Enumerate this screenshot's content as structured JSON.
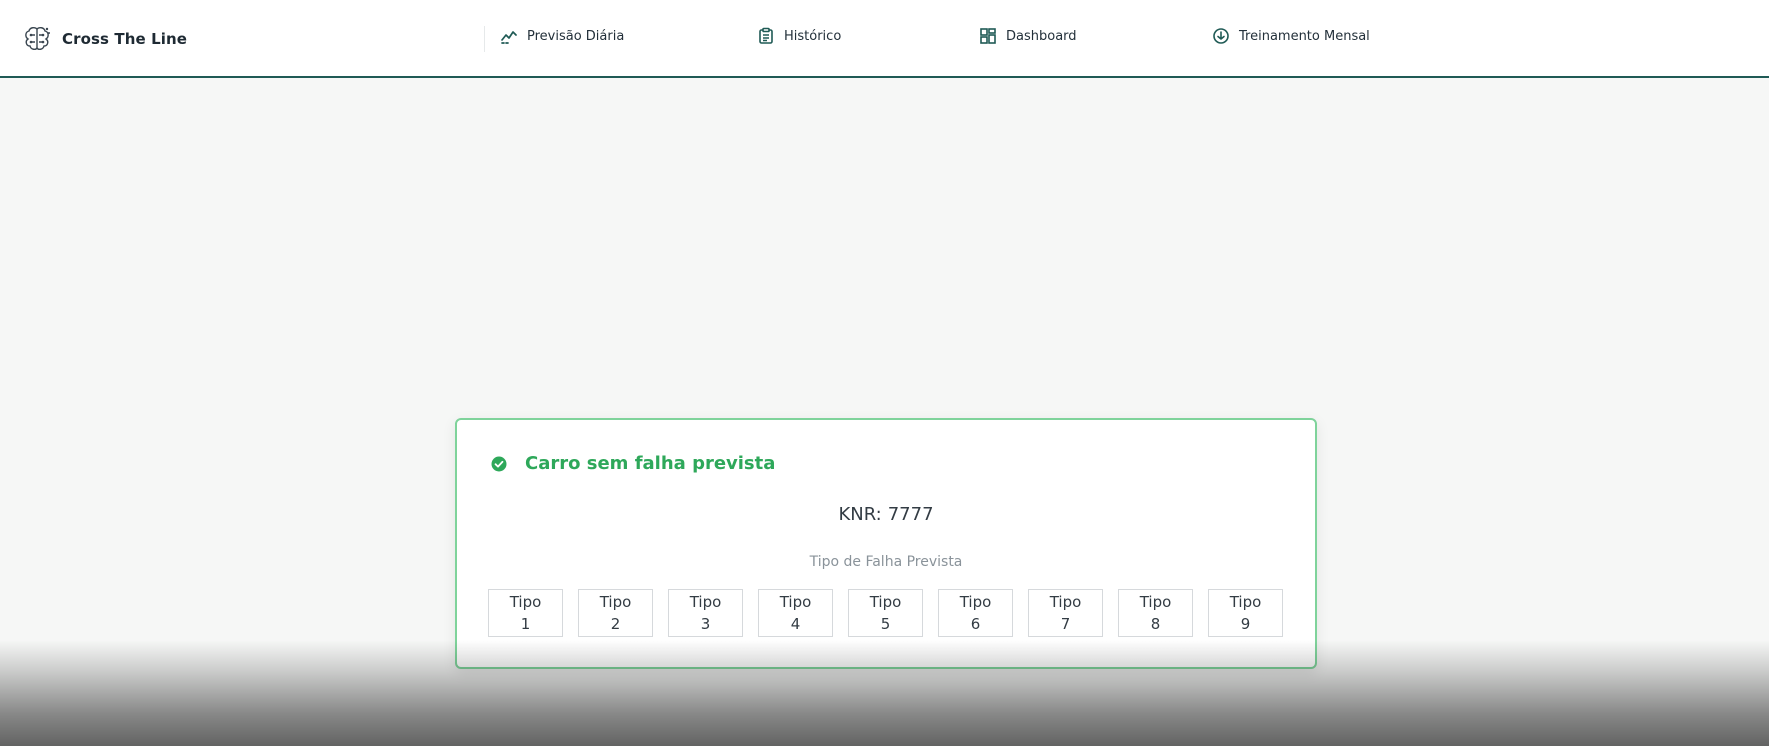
{
  "brand": {
    "name": "Cross The Line",
    "logo": "brain-circuit-icon"
  },
  "nav": [
    {
      "label": "Previsão Diária",
      "icon": "trend-chart-icon"
    },
    {
      "label": "Histórico",
      "icon": "clipboard-icon"
    },
    {
      "label": "Dashboard",
      "icon": "dashboard-grid-icon"
    },
    {
      "label": "Treinamento Mensal",
      "icon": "download-circle-icon"
    }
  ],
  "result": {
    "status_title": "Carro sem falha prevista",
    "status_icon": "check-circle-icon",
    "knr_label": "KNR:",
    "knr_value": "7777",
    "failure_type_label": "Tipo de Falha Prevista",
    "types": [
      {
        "word": "Tipo",
        "num": "1"
      },
      {
        "word": "Tipo",
        "num": "2"
      },
      {
        "word": "Tipo",
        "num": "3"
      },
      {
        "word": "Tipo",
        "num": "4"
      },
      {
        "word": "Tipo",
        "num": "5"
      },
      {
        "word": "Tipo",
        "num": "6"
      },
      {
        "word": "Tipo",
        "num": "7"
      },
      {
        "word": "Tipo",
        "num": "8"
      },
      {
        "word": "Tipo",
        "num": "9"
      }
    ]
  },
  "colors": {
    "accent": "#1f5a55",
    "success": "#2ea85a",
    "card_border": "#7fd39b"
  }
}
